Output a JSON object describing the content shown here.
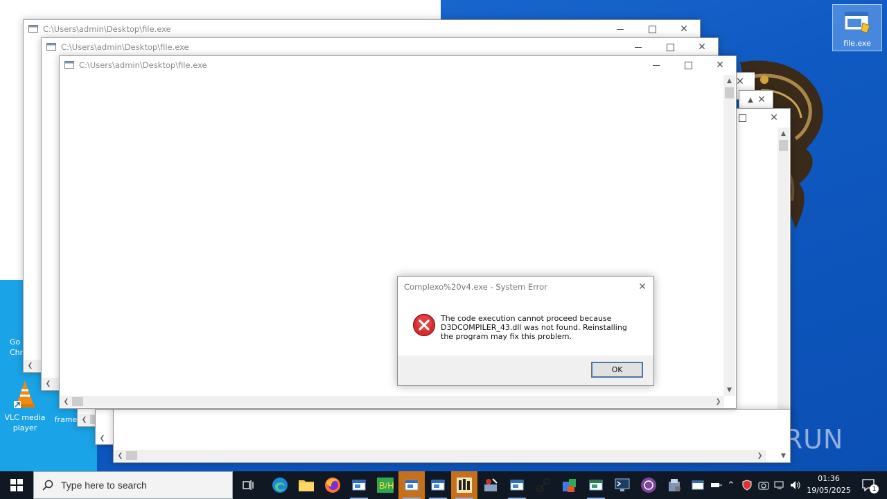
{
  "desktop": {
    "icons": [
      {
        "label": "file.exe"
      },
      {
        "label": "Go\nChr"
      },
      {
        "label": "VLC media\nplayer"
      },
      {
        "label": "frame"
      }
    ],
    "watermark": "ANY RUN"
  },
  "windows": [
    {
      "title": "C:\\Users\\admin\\Desktop\\file.exe"
    },
    {
      "title": "C:\\Users\\admin\\Desktop\\file.exe"
    },
    {
      "title": "C:\\Users\\admin\\Desktop\\file.exe"
    }
  ],
  "dialog": {
    "title": "Complexo%20v4.exe - System Error",
    "message": "The code execution cannot proceed because D3DCOMPILER_43.dll was not found. Reinstalling the program may fix this problem.",
    "ok_label": "OK",
    "icon": "error-icon"
  },
  "taskbar": {
    "search_placeholder": "Type here to search",
    "time": "01:36",
    "date": "19/05/2025",
    "notification_count": "1",
    "pinned": [
      "task-view",
      "edge",
      "file-explorer",
      "firefox",
      "window",
      "bh-app",
      "window",
      "window",
      "app-grid",
      "network-tool",
      "window",
      "link-tool",
      "office",
      "window",
      "terminal",
      "tor",
      "installer"
    ]
  }
}
